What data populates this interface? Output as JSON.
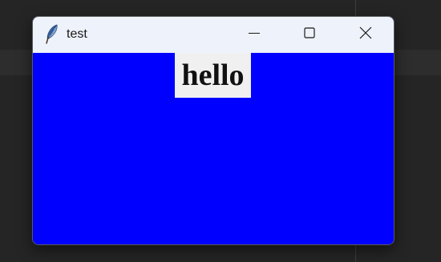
{
  "window": {
    "title": "test",
    "app_icon": "feather-icon",
    "controls": {
      "minimize_icon": "minimize-icon",
      "maximize_icon": "maximize-icon",
      "close_icon": "close-icon"
    }
  },
  "content": {
    "label_text": "hello",
    "background_color": "#0000ff",
    "label_background": "#f0f0f0"
  },
  "desktop": {
    "background_color": "#252525"
  }
}
